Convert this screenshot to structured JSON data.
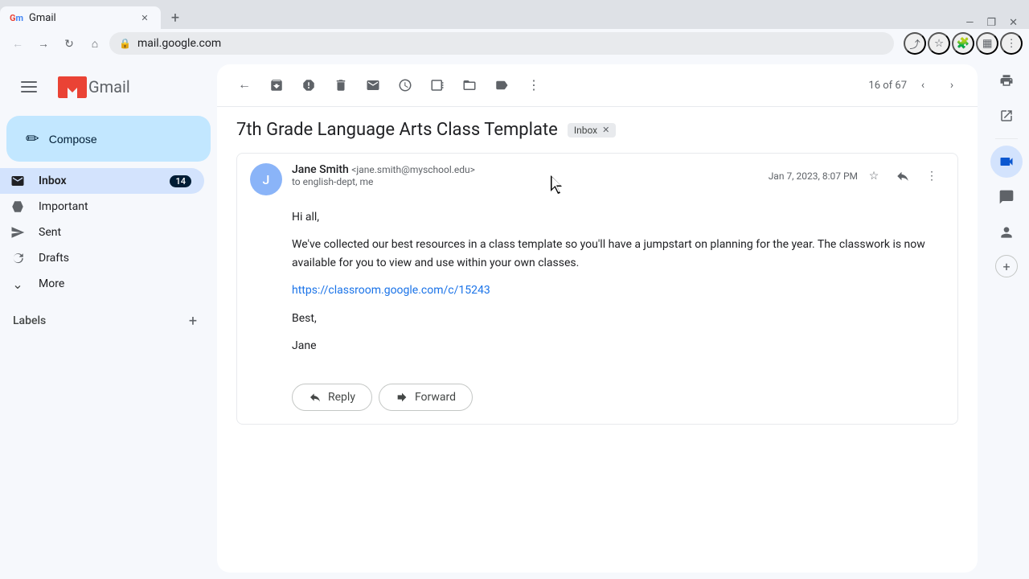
{
  "browser": {
    "tab_title": "Gmail",
    "tab_favicon": "M",
    "url": "mail.google.com",
    "new_tab_icon": "+",
    "nav": {
      "back_title": "Back",
      "forward_title": "Forward",
      "refresh_title": "Refresh",
      "home_title": "Home"
    },
    "end_icons": [
      "share-icon",
      "bookmark-icon",
      "extensions-icon",
      "sidebar-icon",
      "more-icon"
    ]
  },
  "sidebar": {
    "hamburger_title": "Main menu",
    "logo_text": "Gmail",
    "compose_label": "Compose",
    "nav_items": [
      {
        "id": "inbox",
        "label": "Inbox",
        "badge": "14",
        "active": true,
        "icon": "inbox"
      },
      {
        "id": "important",
        "label": "Important",
        "badge": "",
        "active": false,
        "icon": "label-important"
      },
      {
        "id": "sent",
        "label": "Sent",
        "badge": "",
        "active": false,
        "icon": "send"
      },
      {
        "id": "drafts",
        "label": "Drafts",
        "badge": "",
        "active": false,
        "icon": "draft"
      }
    ],
    "more_item": {
      "label": "More",
      "icon": "expand-more"
    },
    "labels_title": "Labels",
    "labels_add_title": "Add label"
  },
  "email_view": {
    "subject": "7th Grade Language Arts Class Template",
    "inbox_badge": "Inbox",
    "toolbar": {
      "back_title": "Back to Inbox",
      "archive_title": "Archive",
      "report_spam_title": "Report spam",
      "delete_title": "Delete",
      "mark_unread_title": "Mark as unread",
      "snooze_title": "Snooze",
      "add_to_tasks_title": "Add to Tasks",
      "move_to_title": "Move to",
      "label_as_title": "Label as",
      "more_title": "More",
      "pagination": "16 of 67"
    },
    "email": {
      "sender_name": "Jane Smith",
      "sender_email": "<jane.smith@myschool.edu>",
      "to": "to english-dept, me",
      "date": "Jan 7, 2023, 8:07 PM",
      "avatar_initials": "J",
      "body_greeting": "Hi all,",
      "body_text": "We've collected our best resources in a class template so you'll have a jumpstart on planning for the year. The classwork is now available for you to view and use within your own classes.",
      "body_link": "https://classroom.google.com/c/15243",
      "body_sign_off": "Best,",
      "body_name": "Jane"
    },
    "reply_button": "Reply",
    "forward_button": "Forward"
  },
  "right_panel": {
    "print_title": "Print",
    "open_in_new_title": "Open in new window",
    "meet_title": "Meet",
    "chat_title": "Chat",
    "contacts_title": "Contacts",
    "add_title": "Add"
  }
}
